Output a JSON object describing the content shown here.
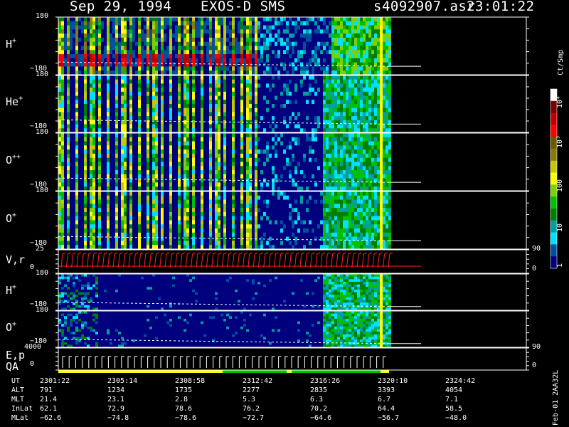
{
  "header": {
    "date": "Sep 29, 1994",
    "instrument": "EXOS-D SMS",
    "file": "s4092907.asr",
    "time": "23:01:22"
  },
  "panels": [
    {
      "id": "hplus-1",
      "label": "H",
      "sup": "+",
      "ymax": "180",
      "ymin": "−180",
      "kind": "spectro",
      "species": "H+"
    },
    {
      "id": "heplus",
      "label": "He",
      "sup": "+",
      "ymax": "180",
      "ymin": "−180",
      "kind": "spectro",
      "species": "He+"
    },
    {
      "id": "oplusplus",
      "label": "O",
      "sup": "++",
      "ymax": "180",
      "ymin": "−180",
      "kind": "spectro",
      "species": "O++"
    },
    {
      "id": "oplus-1",
      "label": "O",
      "sup": "+",
      "ymax": "180",
      "ymin": "−180",
      "kind": "spectro",
      "species": "O+"
    },
    {
      "id": "vr",
      "label": "V,r",
      "sup": "",
      "ymax": "25",
      "ymin": "0",
      "rmax": "90",
      "rmin": "0",
      "kind": "line"
    },
    {
      "id": "hplus-2",
      "label": "H",
      "sup": "+",
      "ymax": "180",
      "ymin": "−180",
      "kind": "spectro2",
      "species": "H+"
    },
    {
      "id": "oplus-2",
      "label": "O",
      "sup": "+",
      "ymax": "180",
      "ymin": "−180",
      "kind": "spectro2",
      "species": "O+"
    },
    {
      "id": "ep",
      "label": "E,p",
      "label2": "QA",
      "sup": "",
      "ymax": "4000",
      "ymin": "0",
      "rmax": "90",
      "rmin": "0",
      "kind": "step"
    }
  ],
  "colorbar": {
    "unit": "Ct/Smp",
    "labels": [
      "10⁴",
      "10³",
      "100",
      "10",
      "1"
    ],
    "colors": [
      "#ffffff",
      "#7a0000",
      "#c00000",
      "#ff0000",
      "#6b5a00",
      "#8c7a00",
      "#c8c800",
      "#ffff00",
      "#7fd000",
      "#00c000",
      "#008000",
      "#00a0a0",
      "#00e0ff",
      "#0050a0",
      "#00007f"
    ]
  },
  "footer": {
    "rows": [
      {
        "label": "UT",
        "values": [
          "2301:22",
          "2305:14",
          "2308:58",
          "2312:42",
          "2316:26",
          "2320:10",
          "2324:42"
        ]
      },
      {
        "label": "ALT",
        "values": [
          "791",
          "1234",
          "1735",
          "2277",
          "2835",
          "3393",
          "4054"
        ]
      },
      {
        "label": "MLT",
        "values": [
          "21.4",
          "23.1",
          "2.8",
          "5.3",
          "6.3",
          "6.7",
          "7.1"
        ]
      },
      {
        "label": "InLat",
        "values": [
          "62.1",
          "72.9",
          "78.6",
          "76.2",
          "70.2",
          "64.4",
          "58.5"
        ]
      },
      {
        "label": "MLat",
        "values": [
          "−62.6",
          "−74.8",
          "−78.6",
          "−72.7",
          "−64.6",
          "−56.7",
          "−48.0"
        ]
      }
    ],
    "side": "Feb-01 2AA32L"
  },
  "chart_data": {
    "type": "heatmap",
    "title": "Sep 29, 1994   EXOS-D SMS",
    "x": [
      "2301:22",
      "2305:14",
      "2308:58",
      "2312:42",
      "2316:26",
      "2320:10",
      "2324:42"
    ],
    "xlabel": "UT",
    "panels": [
      "H+",
      "He+",
      "O++",
      "O+",
      "V,r",
      "H+",
      "O+",
      "E,p / QA"
    ],
    "ylim": [
      -180,
      180
    ],
    "colorscale": {
      "unit": "Ct/Smp",
      "range": [
        1,
        10000
      ],
      "log": true
    },
    "legend": "right"
  }
}
